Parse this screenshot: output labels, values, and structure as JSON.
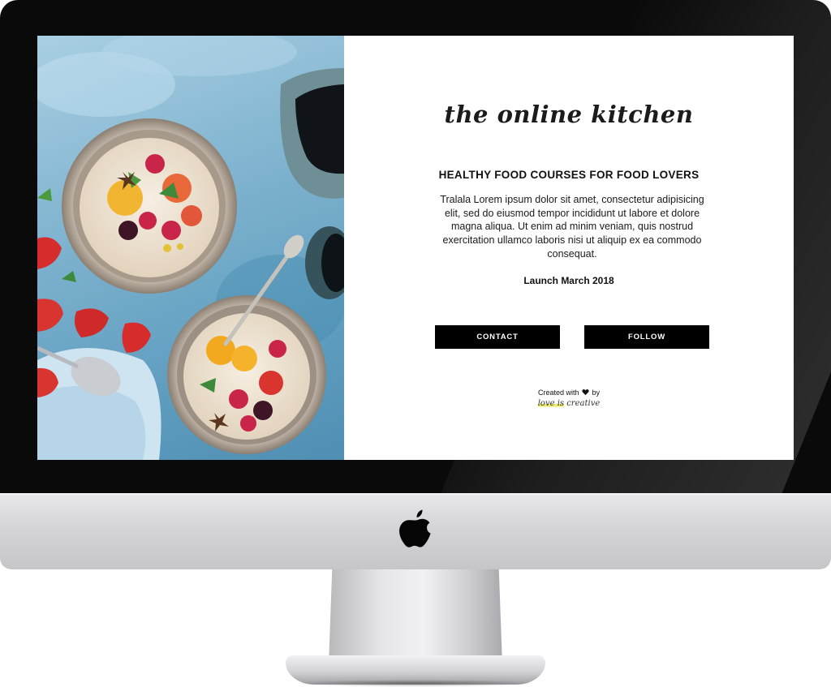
{
  "site": {
    "logo_text": "the online kitchen",
    "headline": "HEALTHY FOOD COURSES FOR FOOD LOVERS",
    "description": "Tralala Lorem ipsum dolor sit amet, consectetur adipisicing elit, sed do eiusmod tempor incididunt ut labore et dolore magna aliqua. Ut enim ad minim veniam, quis nostrud exercitation ullamco laboris nisi ut aliquip ex ea commodo consequat.",
    "launch_text": "Launch March 2018",
    "buttons": {
      "contact_label": "CONTACT",
      "follow_label": "FOLLOW"
    },
    "credit": {
      "prefix": "Created with",
      "icon": "heart-icon",
      "suffix": "by",
      "brand_highlight": "love is",
      "brand_rest": " creative"
    }
  },
  "hero_image": {
    "subject": "two bowls of porridge with fruit",
    "icon": "food-photo"
  },
  "device": {
    "icon": "apple-logo-icon"
  },
  "colors": {
    "button_bg": "#000000",
    "button_text": "#ffffff",
    "highlight": "#e8ea6a",
    "photo_blue": "#7fb3cf"
  }
}
